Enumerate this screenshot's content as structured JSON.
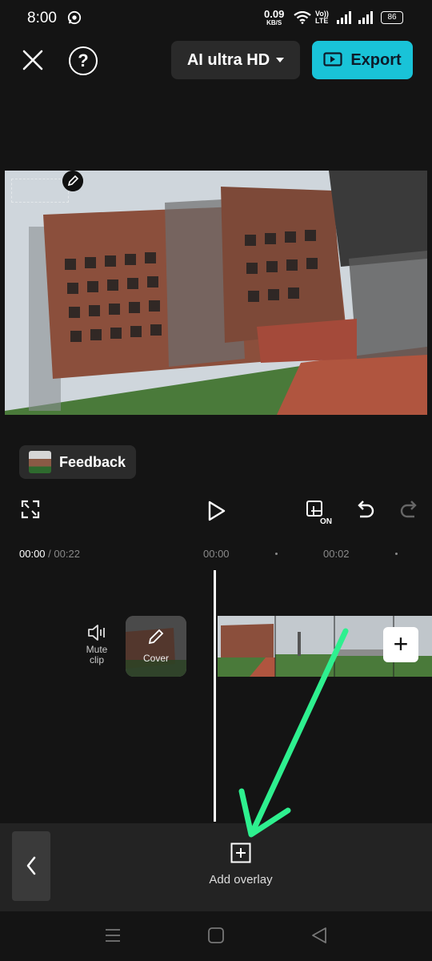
{
  "status_bar": {
    "time": "8:00",
    "net_speed_value": "0.09",
    "net_speed_unit": "KB/S",
    "volte_top": "Vo))",
    "volte_bottom": "LTE",
    "battery": "86"
  },
  "toolbar": {
    "quality_label": "AI ultra HD",
    "export_label": "Export",
    "help_label": "?"
  },
  "feedback": {
    "label": "Feedback"
  },
  "timeline": {
    "current_time": "00:00",
    "separator": " / ",
    "total_duration": "00:22",
    "ruler_marks": [
      "00:00",
      "00:02"
    ],
    "mute_label_line1": "Mute",
    "mute_label_line2": "clip",
    "cover_label": "Cover",
    "add_clip_label": "+"
  },
  "bottom_toolbar": {
    "add_overlay_label": "Add overlay"
  },
  "colors": {
    "accent": "#19c3d8",
    "annotation_arrow": "#2ef08f",
    "background": "#141414"
  },
  "icons": [
    "whatsapp-icon",
    "wifi-icon",
    "signal-icon",
    "close-icon",
    "help-icon",
    "chevron-down-icon",
    "export-icon",
    "edit-icon",
    "fullscreen-icon",
    "play-icon",
    "preview-on-icon",
    "undo-icon",
    "redo-icon",
    "speaker-icon",
    "plus-icon",
    "chevron-left-icon",
    "add-overlay-icon",
    "menu-icon",
    "home-icon",
    "back-icon"
  ]
}
